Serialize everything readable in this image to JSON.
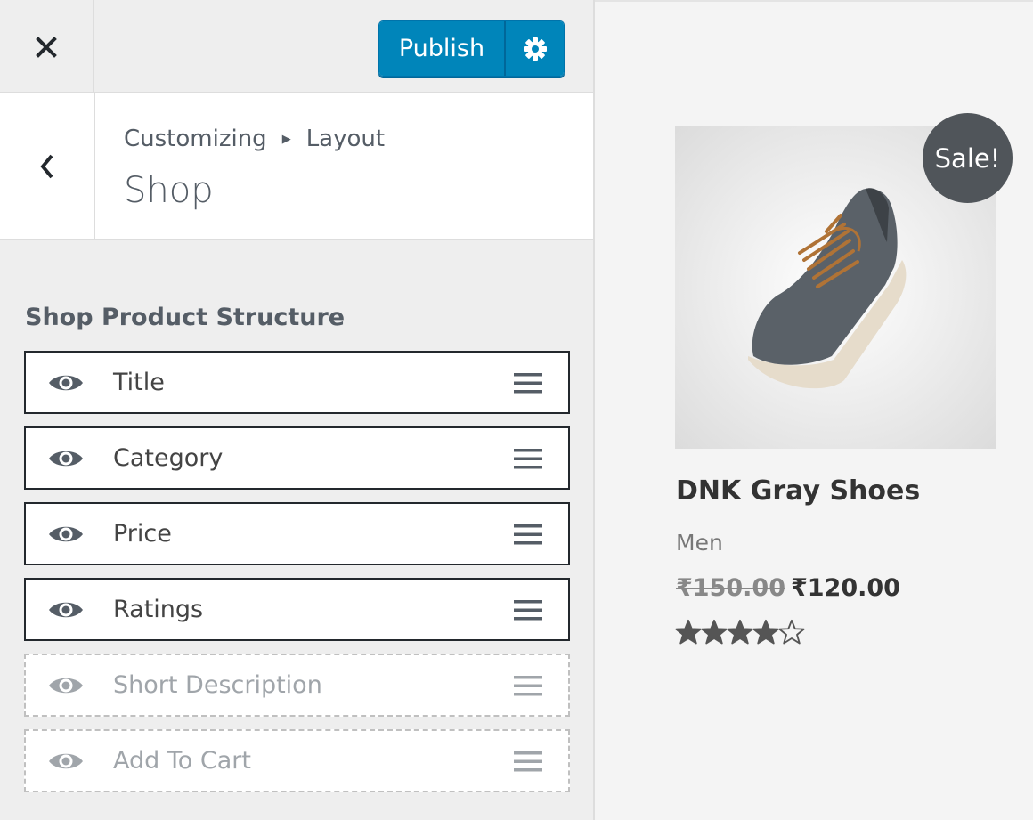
{
  "toolbar": {
    "close_label": "Close",
    "publish_label": "Publish",
    "settings_label": "Publish settings"
  },
  "header": {
    "breadcrumb": [
      "Customizing",
      "Layout"
    ],
    "title": "Shop"
  },
  "section": {
    "title": "Shop Product Structure",
    "items": [
      {
        "label": "Title",
        "enabled": true
      },
      {
        "label": "Category",
        "enabled": true
      },
      {
        "label": "Price",
        "enabled": true
      },
      {
        "label": "Ratings",
        "enabled": true
      },
      {
        "label": "Short Description",
        "enabled": false
      },
      {
        "label": "Add To Cart",
        "enabled": false
      }
    ]
  },
  "preview": {
    "badge": "Sale!",
    "product_title": "DNK Gray Shoes",
    "category": "Men",
    "old_price": "₹150.00",
    "price": "₹120.00",
    "rating": 4,
    "rating_max": 5
  },
  "colors": {
    "accent": "#0085ba",
    "badge": "#50555a",
    "enabled_icon": "#555d66",
    "disabled_icon": "#a0a5aa"
  },
  "icons": {
    "close": "close-icon",
    "settings": "gear-icon",
    "back": "chevron-left-icon",
    "visibility": "eye-icon",
    "reorder": "drag-handle-icon",
    "rating": "star-icon"
  }
}
